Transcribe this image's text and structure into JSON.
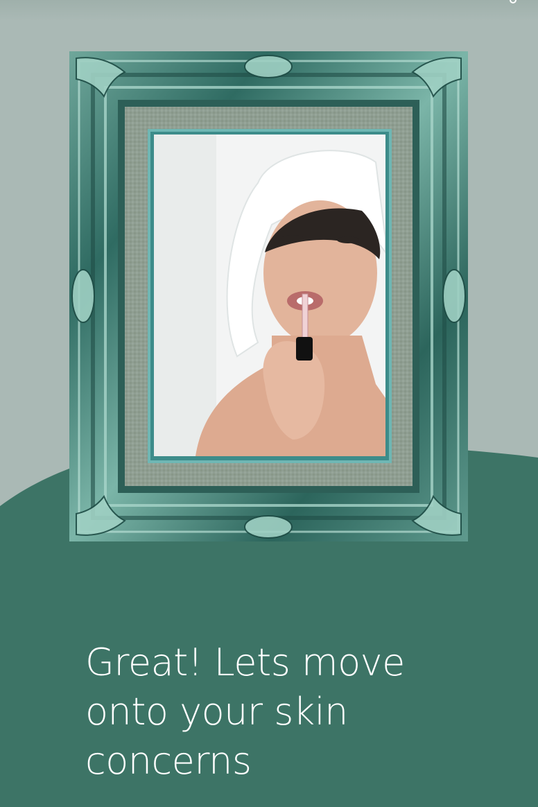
{
  "screen": {
    "heading": "Great! Lets move onto your skin concerns",
    "colors": {
      "background_top": "#aab9b5",
      "background_bottom": "#3d7466",
      "frame": "#3c7a70",
      "frame_highlight": "#a9d4c8",
      "mat": "#8e9e91",
      "heading_text": "#ffffff"
    }
  },
  "frame_photo": {
    "subject": "woman with towel applying lip gloss",
    "icon": "framed-photo"
  }
}
